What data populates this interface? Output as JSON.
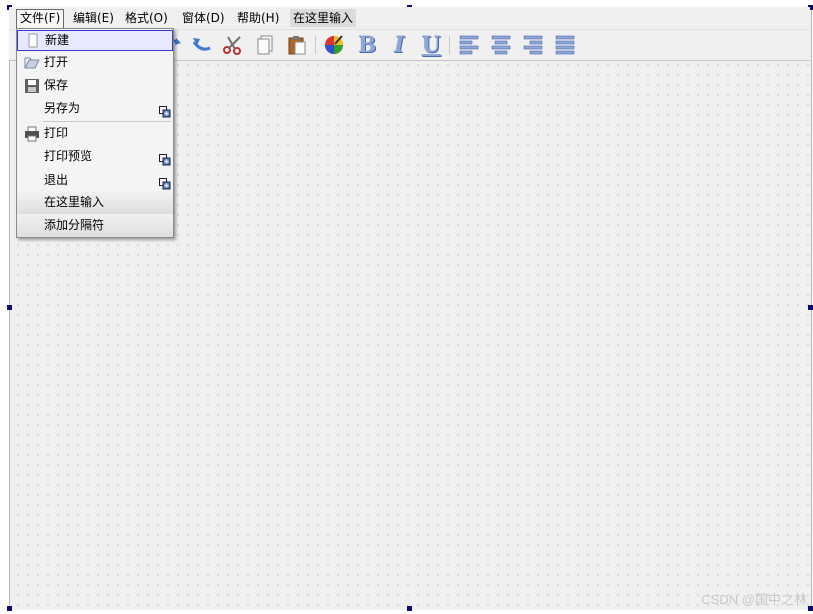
{
  "menubar": {
    "file": "文件(F)",
    "edit": "编辑(E)",
    "format": "格式(O)",
    "window": "窗体(D)",
    "help": "帮助(H)",
    "type_here": "在这里输入"
  },
  "toolbar": {
    "icons": [
      "redo-icon",
      "undo-icon",
      "cut-icon",
      "copy-icon",
      "paste-icon",
      "color-icon",
      "bold-icon",
      "italic-icon",
      "underline-icon",
      "align-left-icon",
      "align-center-icon",
      "align-right-icon",
      "justify-icon"
    ],
    "bold": "B",
    "italic": "I",
    "underline": "U"
  },
  "file_menu": {
    "new": "新建",
    "open": "打开",
    "save": "保存",
    "save_as": "另存为",
    "print": "打印",
    "print_preview": "打印预览",
    "exit": "退出",
    "type_here": "在这里输入",
    "add_separator": "添加分隔符"
  },
  "watermark": "CSDN @国中之林",
  "colors": {
    "form_bg": "#f0f0f0",
    "highlight_border": "#3a3ad0",
    "handle": "#0a0a7a",
    "format_letters": "#8fa6d8"
  }
}
